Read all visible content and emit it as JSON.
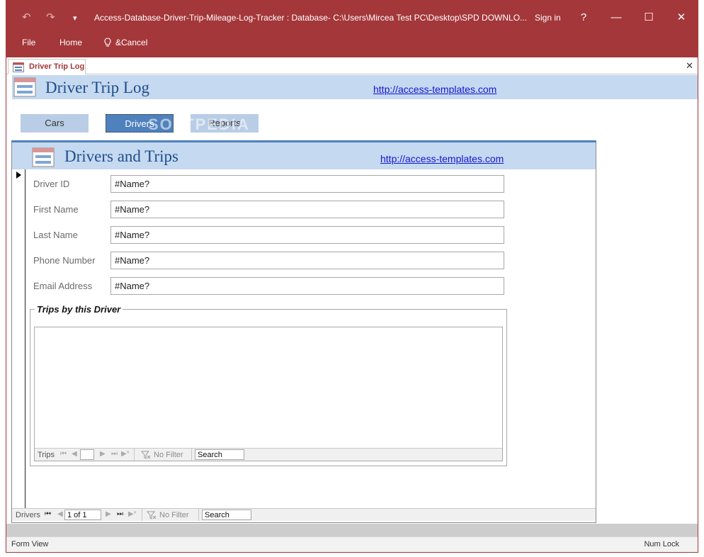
{
  "window": {
    "title": "Access-Database-Driver-Trip-Mileage-Log-Tracker : Database- C:\\Users\\Mircea Test PC\\Desktop\\SPD DOWNLO...",
    "sign_in": "Sign in",
    "help": "?",
    "minimize": "—",
    "maximize": "☐",
    "close": "✕"
  },
  "quick_access": {
    "undo": "↶",
    "redo": "↷",
    "customize": "⩡"
  },
  "menu": {
    "file": "File",
    "home": "Home",
    "tell_me_icon": "💡",
    "tell_me": "&Cancel"
  },
  "doc_tab": {
    "label": "Driver Trip Log",
    "close": "✕"
  },
  "app": {
    "title": "Driver Trip Log",
    "link": "http://access-templates.com",
    "nav": {
      "cars": "Cars",
      "drivers": "Drivers",
      "reports": "Reports"
    }
  },
  "subform": {
    "title": "Drivers and Trips",
    "link": "http://access-templates.com",
    "fields": [
      {
        "label": "Driver ID",
        "value": "#Name?"
      },
      {
        "label": "First Name",
        "value": "#Name?"
      },
      {
        "label": "Last Name",
        "value": "#Name?"
      },
      {
        "label": "Phone Number",
        "value": "#Name?"
      },
      {
        "label": "Email Address",
        "value": "#Name?"
      }
    ],
    "trips_group_title": "Trips by this Driver",
    "trips_nav": {
      "label": "Trips",
      "record": "",
      "no_filter": "No Filter",
      "search": "Search"
    }
  },
  "record_nav": {
    "label": "Drivers",
    "record": "1 of 1",
    "no_filter": "No Filter",
    "search": "Search"
  },
  "nav_icons": {
    "first": "⏮",
    "prev": "◀",
    "next": "▶",
    "last": "⏭",
    "new": "▶*"
  },
  "status": {
    "left": "Form View",
    "right": "Num Lock"
  },
  "watermark": "SOFTPEDIA",
  "colors": {
    "access_red": "#a4373a",
    "header_blue": "#c5d9f0",
    "active_nav": "#4f81bd"
  }
}
